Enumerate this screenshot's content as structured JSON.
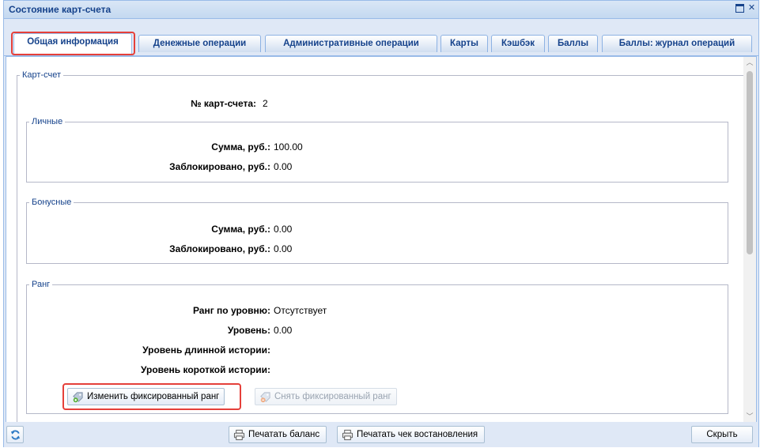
{
  "window": {
    "title": "Состояние карт-счета",
    "tools": {
      "maximize": "maximize-icon",
      "close": "✕"
    }
  },
  "tabs": [
    {
      "label": "Общая информация",
      "active": true
    },
    {
      "label": "Денежные операции",
      "active": false
    },
    {
      "label": "Административные операции",
      "active": false
    },
    {
      "label": "Карты",
      "active": false
    },
    {
      "label": "Кэшбэк",
      "active": false
    },
    {
      "label": "Баллы",
      "active": false
    },
    {
      "label": "Баллы: журнал операций",
      "active": false
    }
  ],
  "account": {
    "legend": "Карт-счет",
    "number_label": "№ карт-счета:",
    "number_value": "2"
  },
  "personal": {
    "legend": "Личные",
    "sum_label": "Сумма, руб.:",
    "sum_value": "100.00",
    "blocked_label": "Заблокировано, руб.:",
    "blocked_value": "0.00"
  },
  "bonus": {
    "legend": "Бонусные",
    "sum_label": "Сумма, руб.:",
    "sum_value": "0.00",
    "blocked_label": "Заблокировано, руб.:",
    "blocked_value": "0.00"
  },
  "rank": {
    "legend": "Ранг",
    "by_level_label": "Ранг по уровню:",
    "by_level_value": "Отсутствует",
    "level_label": "Уровень:",
    "level_value": "0.00",
    "long_history_label": "Уровень длинной истории:",
    "short_history_label": "Уровень короткой истории:",
    "change_button": "Изменить фиксированный ранг",
    "remove_button": "Снять фиксированный ранг"
  },
  "bottom": {
    "print_balance": "Печатать баланс",
    "print_receipt": "Печатать чек востановления",
    "hide": "Скрыть"
  },
  "colors": {
    "accent": "#15428b",
    "highlight": "#e5403a",
    "panel": "#dfe8f6"
  }
}
